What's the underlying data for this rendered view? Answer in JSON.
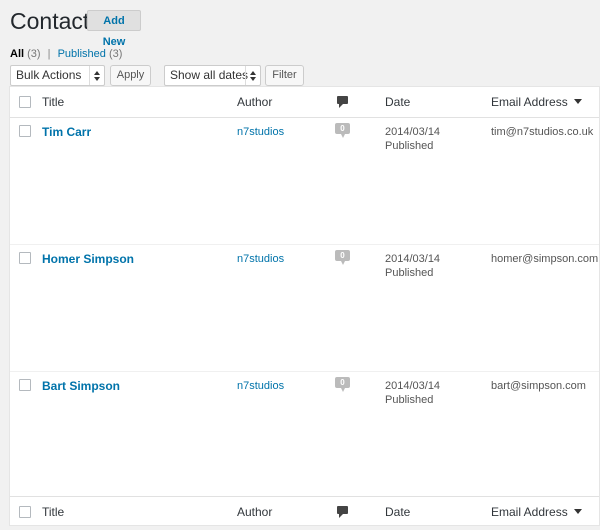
{
  "page": {
    "title": "Contacts",
    "add_new": "Add New"
  },
  "filters": {
    "all": {
      "label": "All",
      "count": "(3)"
    },
    "separator": "|",
    "published": {
      "label": "Published",
      "count": "(3)"
    }
  },
  "tablenav": {
    "bulk_actions": "Bulk Actions",
    "apply": "Apply",
    "dates": "Show all dates",
    "filter": "Filter"
  },
  "columns": {
    "title": "Title",
    "author": "Author",
    "date": "Date",
    "email": "Email Address"
  },
  "rows": [
    {
      "title": "Tim Carr",
      "author": "n7studios",
      "comments": "0",
      "date": "2014/03/14",
      "status": "Published",
      "email": "tim@n7studios.co.uk"
    },
    {
      "title": "Homer Simpson",
      "author": "n7studios",
      "comments": "0",
      "date": "2014/03/14",
      "status": "Published",
      "email": "homer@simpson.com"
    },
    {
      "title": "Bart Simpson",
      "author": "n7studios",
      "comments": "0",
      "date": "2014/03/14",
      "status": "Published",
      "email": "bart@simpson.com"
    }
  ]
}
